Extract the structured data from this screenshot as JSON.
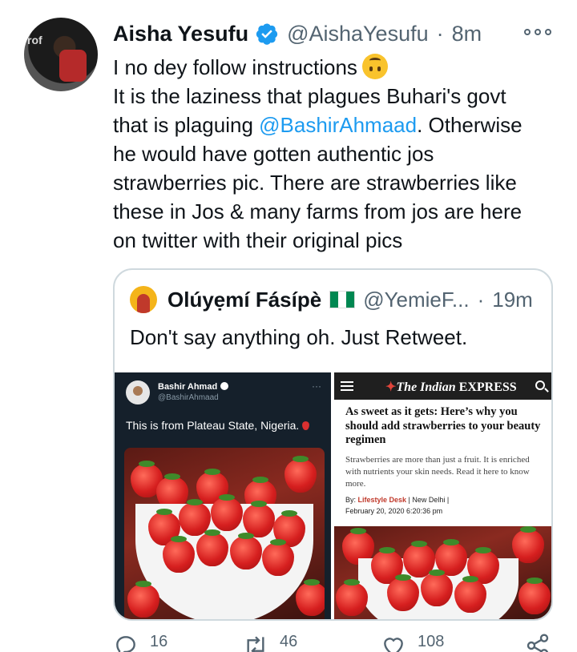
{
  "tweet": {
    "author_name": "Aisha Yesufu",
    "author_handle": "@AishaYesufu",
    "separator": "·",
    "time": "8m",
    "text_lines": [
      {
        "before": "I no dey follow instructions",
        "mention": "",
        "after": ""
      },
      {
        "before": "It is the laziness that plagues Buhari's govt",
        "mention": "",
        "after": ""
      },
      {
        "before": "that is plaguing ",
        "mention": "@BashirAhmaad",
        "after": ". Otherwise"
      },
      {
        "before": "he would have gotten authentic jos",
        "mention": "",
        "after": ""
      },
      {
        "before": "strawberries pic. There are strawberries like",
        "mention": "",
        "after": ""
      },
      {
        "before": "these in Jos & many farms from jos are here",
        "mention": "",
        "after": ""
      },
      {
        "before": "on twitter with their original pics",
        "mention": "",
        "after": ""
      }
    ],
    "emoji": "upside-down-face-emoji"
  },
  "quoted_tweet": {
    "author_name": "Olúyẹmí Fásípè",
    "author_handle": "@YemieF...",
    "separator": "·",
    "time": "19m",
    "text": "Don't say anything oh. Just Retweet.",
    "flag_colors": [
      "#008751",
      "#ffffff",
      "#008751"
    ]
  },
  "media_left": {
    "author_name": "Bashir Ahmad",
    "author_handle": "@BashirAhmaad",
    "more": "···",
    "text": "This is from Plateau State, Nigeria."
  },
  "media_right": {
    "logo_prefix": "The Indian ",
    "logo_suffix": "EXPRESS",
    "headline": "As sweet as it gets: Here’s why you should add strawberries to your beauty regimen",
    "summary": "Strawberries are more than just a fruit. It is enriched with nutrients your skin needs. Read it here to know more.",
    "byline_prefix": "By: ",
    "byline_author": "Lifestyle Desk",
    "byline_rest": " | New Delhi |",
    "date": "February 20, 2020 6:20:36 pm"
  },
  "actions": {
    "reply_count": "16",
    "retweet_count": "46",
    "like_count": "108",
    "icons": [
      "reply-icon",
      "retweet-icon",
      "like-icon",
      "share-icon"
    ]
  },
  "colors": {
    "link": "#1d9bf0",
    "secondary_text": "#536471",
    "border": "#cfd9de",
    "verified": "#1d9bf0"
  }
}
